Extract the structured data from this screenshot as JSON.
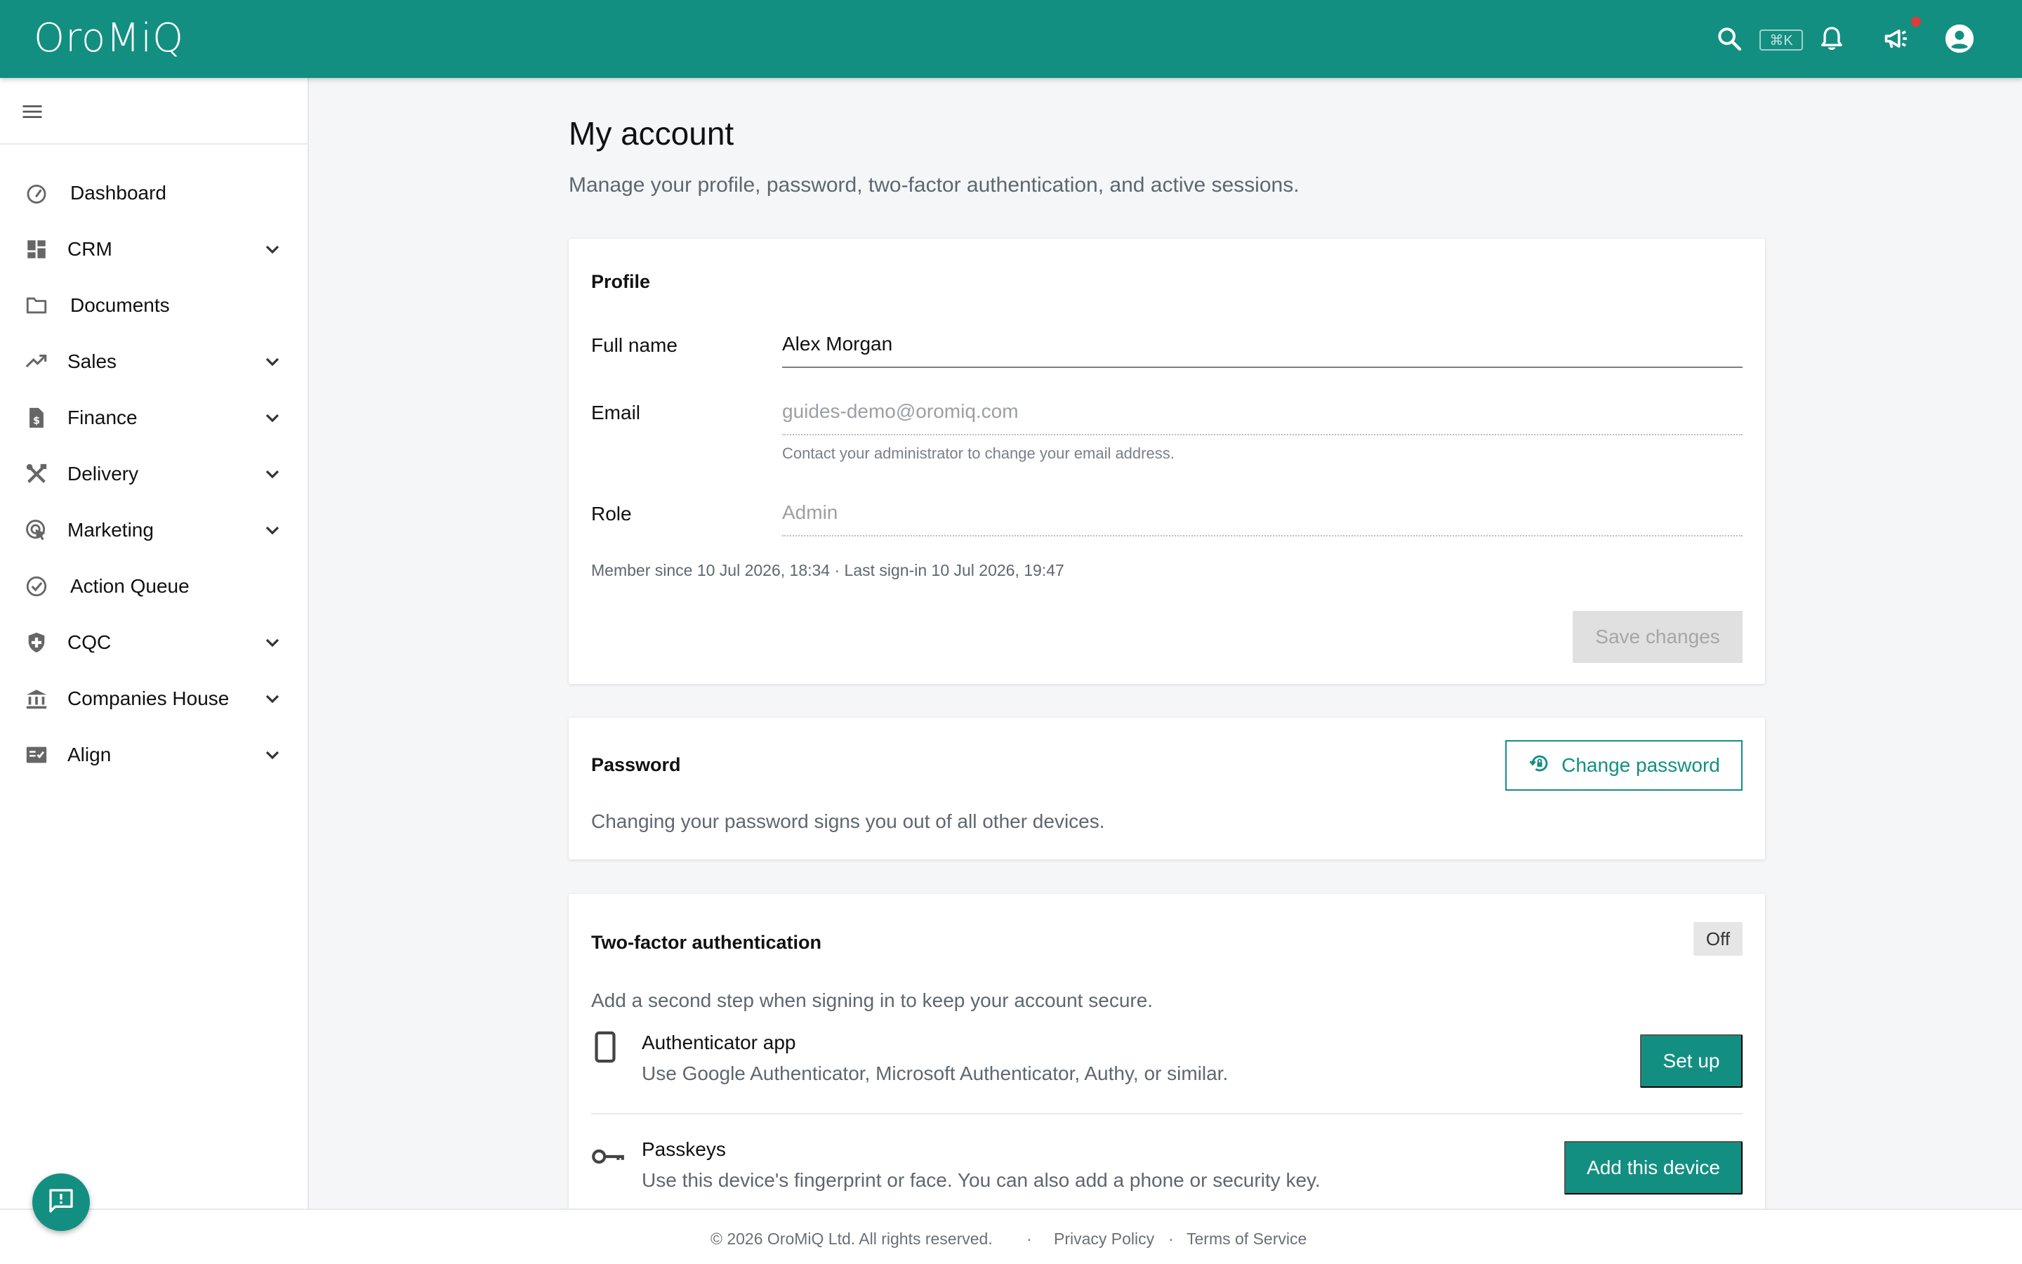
{
  "app": {
    "name": "OroMiQ",
    "shortcut": "⌘K",
    "brand_color": "#138f82"
  },
  "topbar": {
    "icons": [
      "search-icon",
      "bell-icon",
      "megaphone-icon",
      "account-circle-icon"
    ]
  },
  "sidebar": {
    "items": [
      {
        "label": "Dashboard",
        "icon": "speedometer-icon",
        "expandable": false
      },
      {
        "label": "CRM",
        "icon": "dashboard-grid-icon",
        "expandable": true
      },
      {
        "label": "Documents",
        "icon": "folder-icon",
        "expandable": false
      },
      {
        "label": "Sales",
        "icon": "trending-up-icon",
        "expandable": true
      },
      {
        "label": "Finance",
        "icon": "invoice-icon",
        "expandable": true
      },
      {
        "label": "Delivery",
        "icon": "tools-icon",
        "expandable": true
      },
      {
        "label": "Marketing",
        "icon": "target-cursor-icon",
        "expandable": true
      },
      {
        "label": "Action Queue",
        "icon": "check-circle-icon",
        "expandable": false
      },
      {
        "label": "CQC",
        "icon": "shield-plus-icon",
        "expandable": true
      },
      {
        "label": "Companies House",
        "icon": "bank-icon",
        "expandable": true
      },
      {
        "label": "Align",
        "icon": "checklist-icon",
        "expandable": true
      }
    ]
  },
  "page": {
    "title": "My account",
    "subtitle": "Manage your profile, password, two-factor authentication, and active sessions."
  },
  "profile": {
    "title": "Profile",
    "full_name_label": "Full name",
    "full_name_value": "Alex Morgan",
    "email_label": "Email",
    "email_value": "guides-demo@oromiq.com",
    "email_helper": "Contact your administrator to change your email address.",
    "role_label": "Role",
    "role_value": "Admin",
    "meta": "Member since 10 Jul 2026, 18:34 · Last sign-in 10 Jul 2026, 19:47",
    "save_label": "Save changes"
  },
  "password": {
    "title": "Password",
    "button_label": "Change password",
    "description": "Changing your password signs you out of all other devices."
  },
  "two_factor": {
    "title": "Two-factor authentication",
    "status": "Off",
    "description": "Add a second step when signing in to keep your account secure.",
    "methods": [
      {
        "title": "Authenticator app",
        "description": "Use Google Authenticator, Microsoft Authenticator, Authy, or similar.",
        "button": "Set up",
        "icon": "phone-icon"
      },
      {
        "title": "Passkeys",
        "description": "Use this device's fingerprint or face. You can also add a phone or security key.",
        "button": "Add this device",
        "icon": "key-icon"
      }
    ]
  },
  "footer": {
    "copyright": "© 2026 OroMiQ Ltd. All rights reserved.",
    "separator": "·",
    "privacy": "Privacy Policy",
    "terms": "Terms of Service"
  }
}
